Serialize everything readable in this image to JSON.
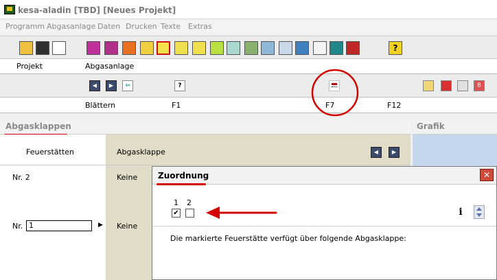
{
  "window": {
    "title": "kesa-aladin [TBD] [Neues Projekt]"
  },
  "menu": [
    "Programm",
    "Abgasanlage",
    "Daten",
    "Drucken",
    "Texte",
    "Extras"
  ],
  "columns": {
    "projekt": "Projekt",
    "abgasanlage": "Abgasanlage"
  },
  "nav": {
    "help_glyph": "?"
  },
  "fkeys": {
    "blaettern": "Blättern",
    "f1": "F1",
    "f7": "F7",
    "f12": "F12"
  },
  "main": {
    "title": "Abgasklappen",
    "col_feuerstaetten": "Feuerstätten",
    "col_abgasklappe": "Abgasklappe",
    "rows": [
      {
        "label": "Nr. 2",
        "value": "Keine"
      },
      {
        "label": "Nr.",
        "input_value": "1",
        "value": "Keine"
      }
    ]
  },
  "grafik": {
    "title": "Grafik"
  },
  "dialog": {
    "title": "Zuordnung",
    "check1_label": "1",
    "check2_label": "2",
    "check1_checked": true,
    "check2_checked": false,
    "message": "Die markierte Feuerstätte verfügt über folgende Abgasklappe:",
    "info_glyph": "i"
  },
  "colors": {
    "annotation_red": "#d40000",
    "grafik_bg": "#c6d6ec",
    "tan_column": "#e0dcc8"
  }
}
